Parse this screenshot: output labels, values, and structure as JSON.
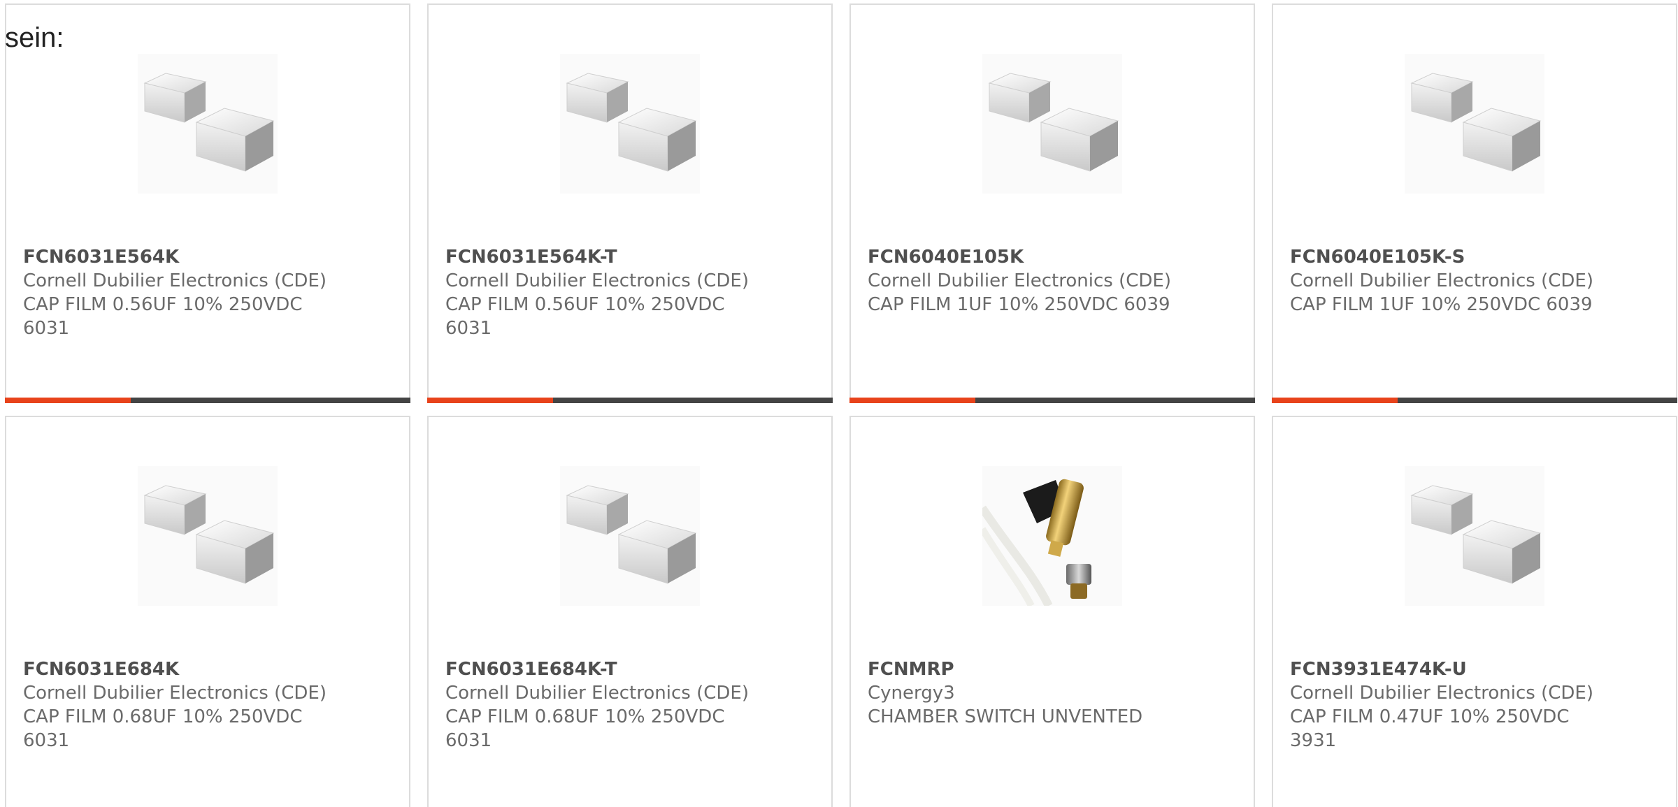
{
  "lead_text": "sein:",
  "colors": {
    "accent": "#e8431b",
    "bar_track": "#444444",
    "border": "#dcdcdc",
    "part_number": "#4f4f4f",
    "body_text": "#6a6a6a"
  },
  "cards": [
    {
      "part_number": "FCN6031E564K",
      "manufacturer": "Cornell Dubilier Electronics (CDE)",
      "description": "CAP FILM 0.56UF 10% 250VDC 6031",
      "image": "film-capacitor-image",
      "progress": 0.31
    },
    {
      "part_number": "FCN6031E564K-T",
      "manufacturer": "Cornell Dubilier Electronics (CDE)",
      "description": "CAP FILM 0.56UF 10% 250VDC 6031",
      "image": "film-capacitor-image",
      "progress": 0.31
    },
    {
      "part_number": "FCN6040E105K",
      "manufacturer": "Cornell Dubilier Electronics (CDE)",
      "description": "CAP FILM 1UF 10% 250VDC 6039",
      "image": "film-capacitor-image",
      "progress": 0.31
    },
    {
      "part_number": "FCN6040E105K-S",
      "manufacturer": "Cornell Dubilier Electronics (CDE)",
      "description": "CAP FILM 1UF 10% 250VDC 6039",
      "image": "film-capacitor-image",
      "progress": 0.31
    },
    {
      "part_number": "FCN6031E684K",
      "manufacturer": "Cornell Dubilier Electronics (CDE)",
      "description": "CAP FILM 0.68UF 10% 250VDC 6031",
      "image": "film-capacitor-image"
    },
    {
      "part_number": "FCN6031E684K-T",
      "manufacturer": "Cornell Dubilier Electronics (CDE)",
      "description": "CAP FILM 0.68UF 10% 250VDC 6031",
      "image": "film-capacitor-image"
    },
    {
      "part_number": "FCNMRP",
      "manufacturer": "Cynergy3",
      "description": "CHAMBER SWITCH UNVENTED",
      "image": "chamber-switch-image"
    },
    {
      "part_number": "FCN3931E474K-U",
      "manufacturer": "Cornell Dubilier Electronics (CDE)",
      "description": "CAP FILM 0.47UF 10% 250VDC 3931",
      "image": "film-capacitor-image"
    }
  ]
}
